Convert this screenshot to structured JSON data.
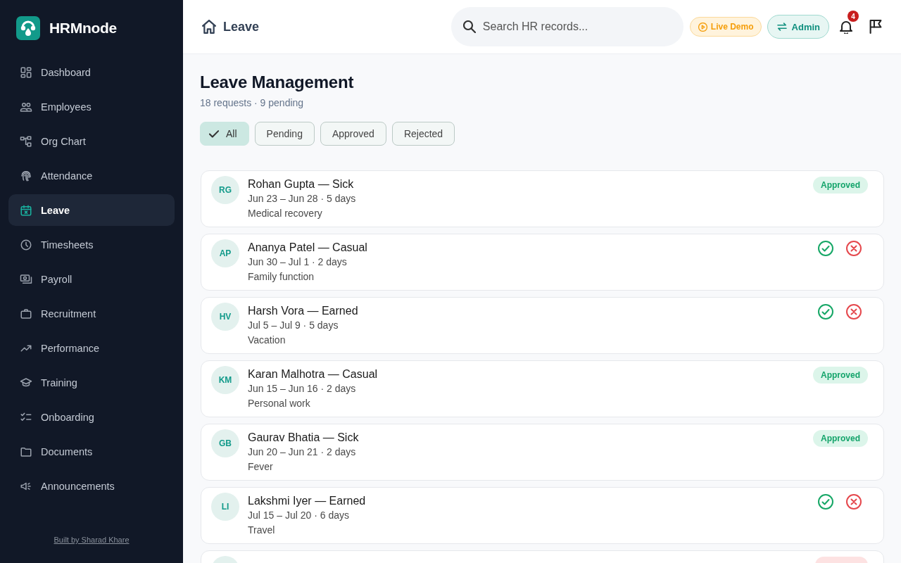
{
  "sidebar": {
    "brand": "HRMnode",
    "items": [
      {
        "label": "Dashboard",
        "selected": false
      },
      {
        "label": "Employees",
        "selected": false
      },
      {
        "label": "Org Chart",
        "selected": false
      },
      {
        "label": "Attendance",
        "selected": false
      },
      {
        "label": "Leave",
        "selected": true
      },
      {
        "label": "Timesheets",
        "selected": false
      },
      {
        "label": "Payroll",
        "selected": false
      },
      {
        "label": "Recruitment",
        "selected": false
      },
      {
        "label": "Performance",
        "selected": false
      },
      {
        "label": "Training",
        "selected": false
      },
      {
        "label": "Onboarding",
        "selected": false
      },
      {
        "label": "Documents",
        "selected": false
      },
      {
        "label": "Announcements",
        "selected": false
      }
    ],
    "footer_link": "Built by Sharad Khare"
  },
  "header": {
    "breadcrumb": "Leave",
    "search": {
      "placeholder": "Search HR records..."
    },
    "demo_badge": "Live Demo",
    "role_button": "Admin",
    "notification_count": "4"
  },
  "page": {
    "title": "Leave Management",
    "subtitle": "18 requests · 9 pending",
    "filters": [
      {
        "label": "All",
        "selected": true
      },
      {
        "label": "Pending",
        "selected": false
      },
      {
        "label": "Approved",
        "selected": false
      },
      {
        "label": "Rejected",
        "selected": false
      }
    ]
  },
  "requests": [
    {
      "kind": "approved",
      "initials": "RG",
      "title": "Rohan Gupta — Sick",
      "dates": "Jun 23 – Jun 28 · 5 days",
      "reason": "Medical recovery",
      "badge": "Approved"
    },
    {
      "kind": "pending",
      "initials": "AP",
      "title": "Ananya Patel — Casual",
      "dates": "Jun 30 – Jul 1 · 2 days",
      "reason": "Family function"
    },
    {
      "kind": "pending",
      "initials": "HV",
      "title": "Harsh Vora — Earned",
      "dates": "Jul 5 – Jul 9 · 5 days",
      "reason": "Vacation"
    },
    {
      "kind": "approved",
      "initials": "KM",
      "title": "Karan Malhotra — Casual",
      "dates": "Jun 15 – Jun 16 · 2 days",
      "reason": "Personal work",
      "badge": "Approved"
    },
    {
      "kind": "approved",
      "initials": "GB",
      "title": "Gaurav Bhatia — Sick",
      "dates": "Jun 20 – Jun 21 · 2 days",
      "reason": "Fever",
      "badge": "Approved"
    },
    {
      "kind": "pending",
      "initials": "LI",
      "title": "Lakshmi Iyer — Earned",
      "dates": "Jul 15 – Jul 20 · 6 days",
      "reason": "Travel"
    },
    {
      "kind": "rejected"
    }
  ]
}
